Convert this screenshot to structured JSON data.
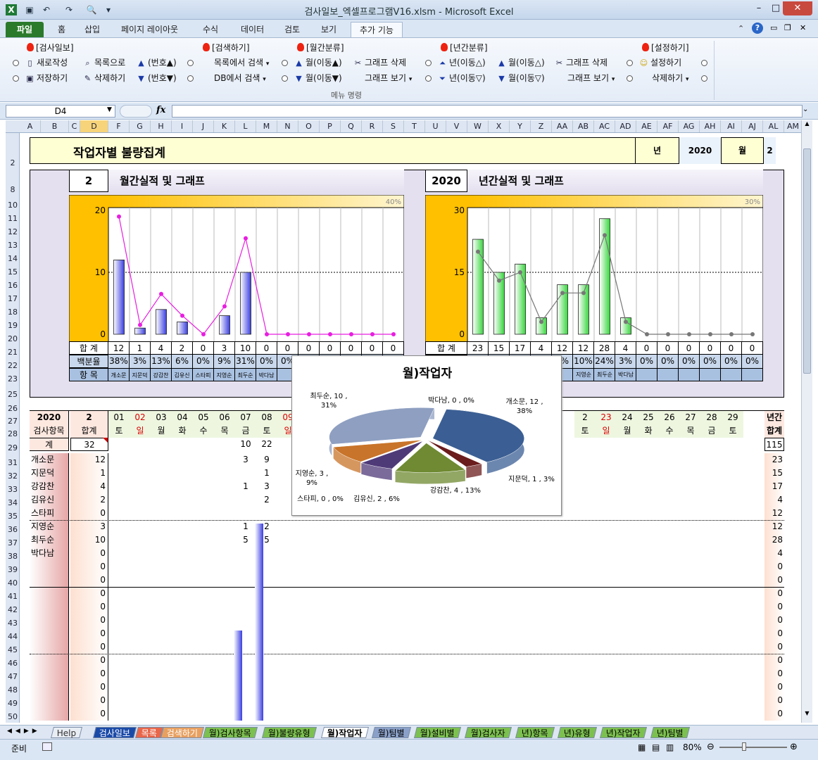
{
  "window": {
    "title": "검사일보_엑셀프로그램V16.xlsm  -  Microsoft Excel"
  },
  "ribbon_tabs": [
    "파일",
    "홈",
    "삽입",
    "페이지 레이아웃",
    "수식",
    "데이터",
    "검토",
    "보기",
    "추가 기능"
  ],
  "ribbon": {
    "groups": [
      "[검사일보]",
      "[검색하기]",
      "[월간분류]",
      "[년간분류]",
      "[설정하기]"
    ],
    "items": {
      "new": "새로작성",
      "save": "저장하기",
      "tolist": "목록으로",
      "delete": "삭제하기",
      "num_up": "(번호▲)",
      "num_down": "(번호▼)",
      "search_list": "목록에서 검색",
      "search_db": "DB에서 검색",
      "month_up": "월(이동▲)",
      "month_down": "월(이동▼)",
      "m_graph_del": "그래프 삭제",
      "m_graph_view": "그래프 보기",
      "year_up": "년(이동△)",
      "year_down": "년(이동▽)",
      "ym_up": "월(이동△)",
      "ym_down": "월(이동▽)",
      "y_graph_del": "그래프 삭제",
      "y_graph_view": "그래프 보기",
      "settings": "설정하기",
      "settings_del": "삭제하기"
    },
    "group_label": "메뉴 명령"
  },
  "namebox": "D4",
  "columns": [
    "A",
    "B",
    "C",
    "D",
    "F",
    "G",
    "H",
    "I",
    "J",
    "K",
    "L",
    "M",
    "N",
    "O",
    "P",
    "Q",
    "R",
    "S",
    "T",
    "U",
    "V",
    "W",
    "X",
    "Y",
    "Z",
    "AA",
    "AB",
    "AC",
    "AD",
    "AE",
    "AF",
    "AG",
    "AH",
    "AI",
    "AJ",
    "AL",
    "AM"
  ],
  "rows": [
    "2",
    "8",
    "10",
    "11",
    "12",
    "13",
    "14",
    "15",
    "16",
    "17",
    "18",
    "19",
    "20",
    "21",
    "22",
    "23",
    "25",
    "26",
    "27",
    "28",
    "29",
    "31",
    "32",
    "33",
    "34",
    "35",
    "36",
    "37",
    "38",
    "39",
    "40",
    "41",
    "42",
    "43",
    "44",
    "45",
    "46",
    "47",
    "48",
    "49",
    "50"
  ],
  "sheet": {
    "title": "작업자별 불량집계",
    "year_label": "년",
    "year": "2020",
    "month_label": "월",
    "month": "2",
    "monthly_header": {
      "num": "2",
      "text": "월간실적 및 그래프"
    },
    "yearly_header": {
      "num": "2020",
      "text": "년간실적 및 그래프"
    },
    "row_total": "합 계",
    "row_pct": "백분율",
    "row_item": "항 목",
    "grid_year": "2020",
    "grid_month": "2",
    "grid_item_hdr": "검사항목",
    "grid_sum_hdr": "합계",
    "grid_total_label": "계",
    "grid_total": "32",
    "grid_total_d07": "10",
    "grid_total_d08": "22",
    "grid_year_total_hdr1": "년간",
    "grid_year_total_hdr2": "합계",
    "grid_year_total": "115"
  },
  "days_left": [
    {
      "d": "01",
      "w": "토",
      "red": false
    },
    {
      "d": "02",
      "w": "일",
      "red": true
    },
    {
      "d": "03",
      "w": "월",
      "red": false
    },
    {
      "d": "04",
      "w": "화",
      "red": false
    },
    {
      "d": "05",
      "w": "수",
      "red": false
    },
    {
      "d": "06",
      "w": "목",
      "red": false
    },
    {
      "d": "07",
      "w": "금",
      "red": false
    },
    {
      "d": "08",
      "w": "토",
      "red": false
    },
    {
      "d": "09",
      "w": "일",
      "red": true
    }
  ],
  "days_right": [
    {
      "d": "2",
      "w": "토",
      "red": false
    },
    {
      "d": "23",
      "w": "일",
      "red": true
    },
    {
      "d": "24",
      "w": "월",
      "red": false
    },
    {
      "d": "25",
      "w": "화",
      "red": false
    },
    {
      "d": "26",
      "w": "수",
      "red": false
    },
    {
      "d": "27",
      "w": "목",
      "red": false
    },
    {
      "d": "28",
      "w": "금",
      "red": false
    },
    {
      "d": "29",
      "w": "토",
      "red": false
    }
  ],
  "workers": [
    {
      "name": "개소문",
      "sum": "12",
      "d07": "3",
      "d08": "9",
      "year": "23"
    },
    {
      "name": "지문덕",
      "sum": "1",
      "d07": "",
      "d08": "1",
      "year": "15"
    },
    {
      "name": "강감찬",
      "sum": "4",
      "d07": "1",
      "d08": "3",
      "year": "17"
    },
    {
      "name": "김유신",
      "sum": "2",
      "d07": "",
      "d08": "2",
      "year": "4"
    },
    {
      "name": "스타피",
      "sum": "0",
      "d07": "",
      "d08": "",
      "year": "12"
    },
    {
      "name": "지영순",
      "sum": "3",
      "d07": "1",
      "d08": "2",
      "year": "12"
    },
    {
      "name": "최두순",
      "sum": "10",
      "d07": "5",
      "d08": "5",
      "year": "28"
    },
    {
      "name": "박다남",
      "sum": "0",
      "d07": "",
      "d08": "",
      "year": "4"
    },
    {
      "name": "",
      "sum": "0",
      "d07": "",
      "d08": "",
      "year": "0"
    },
    {
      "name": "",
      "sum": "0",
      "d07": "",
      "d08": "",
      "year": "0"
    },
    {
      "name": "",
      "sum": "0",
      "d07": "",
      "d08": "",
      "year": "0"
    },
    {
      "name": "",
      "sum": "0",
      "d07": "",
      "d08": "",
      "year": "0"
    },
    {
      "name": "",
      "sum": "0",
      "d07": "",
      "d08": "",
      "year": "0"
    },
    {
      "name": "",
      "sum": "0",
      "d07": "",
      "d08": "",
      "year": "0"
    },
    {
      "name": "",
      "sum": "0",
      "d07": "",
      "d08": "",
      "year": "0"
    },
    {
      "name": "",
      "sum": "0",
      "d07": "",
      "d08": "",
      "year": "0"
    },
    {
      "name": "",
      "sum": "0",
      "d07": "",
      "d08": "",
      "year": "0"
    },
    {
      "name": "",
      "sum": "0",
      "d07": "",
      "d08": "",
      "year": "0"
    },
    {
      "name": "",
      "sum": "0",
      "d07": "",
      "d08": "",
      "year": "0"
    },
    {
      "name": "",
      "sum": "0",
      "d07": "",
      "d08": "",
      "year": "0"
    }
  ],
  "chart_data": [
    {
      "type": "bar",
      "name": "monthly",
      "categories": [
        "개소문",
        "지문덕",
        "강감찬",
        "김유신",
        "스타피",
        "지영순",
        "최두순",
        "박다남",
        "",
        "",
        "",
        "",
        "",
        "",
        ""
      ],
      "values": [
        12,
        1,
        4,
        2,
        0,
        3,
        10,
        0,
        0,
        0,
        0,
        0,
        0,
        0
      ],
      "pct_labels": [
        "38%",
        "3%",
        "13%",
        "6%",
        "0%",
        "9%",
        "31%",
        "0%",
        "0%",
        "",
        "",
        "",
        "",
        ""
      ],
      "line_pct": [
        38,
        3,
        13,
        6,
        0,
        9,
        31,
        0,
        0,
        0,
        0,
        0,
        0,
        0
      ],
      "ylim": [
        0,
        20
      ],
      "yticks": [
        "0",
        "10",
        "20"
      ],
      "y2max_label": "40%",
      "bar_color": "#3a3ee0",
      "line_color": "#e81ee0"
    },
    {
      "type": "bar",
      "name": "yearly",
      "categories": [
        "",
        "",
        "",
        "",
        "",
        "",
        "",
        "",
        "",
        "",
        "",
        "",
        "",
        ""
      ],
      "values": [
        23,
        15,
        17,
        4,
        12,
        12,
        28,
        4,
        0,
        0,
        0,
        0,
        0,
        0
      ],
      "pct_labels": [
        "",
        "",
        "",
        "",
        "0%",
        "10%",
        "24%",
        "3%",
        "0%",
        "0%",
        "0%",
        "0%",
        "0%",
        "0%"
      ],
      "line_pct": [
        20,
        13,
        15,
        3,
        10,
        10,
        24,
        3,
        0,
        0,
        0,
        0,
        0,
        0
      ],
      "ylim": [
        0,
        30
      ],
      "yticks": [
        "0",
        "15",
        "30"
      ],
      "y2max_label": "30%",
      "bar_color": "#36d63c",
      "line_color": "#777777"
    },
    {
      "type": "pie",
      "name": "월)작업자",
      "title": "월)작업자",
      "slices": [
        {
          "label": "개소문",
          "value": 12,
          "pct": "38%",
          "color": "#3b5f94"
        },
        {
          "label": "지문덕",
          "value": 1,
          "pct": "3%",
          "color": "#6b1c1c"
        },
        {
          "label": "강감찬",
          "value": 4,
          "pct": "13%",
          "color": "#6f8a32"
        },
        {
          "label": "김유신",
          "value": 2,
          "pct": "6%",
          "color": "#4f3a78"
        },
        {
          "label": "스타피",
          "value": 0,
          "pct": "0%",
          "color": "#2c7a84"
        },
        {
          "label": "지영순",
          "value": 3,
          "pct": "9%",
          "color": "#c8742a"
        },
        {
          "label": "최두순",
          "value": 10,
          "pct": "31%",
          "color": "#8e9fc1"
        },
        {
          "label": "박다남",
          "value": 0,
          "pct": "0%",
          "color": "#3f4a5c"
        }
      ],
      "data_labels": [
        "개소문, 12 ,\n38%",
        "지문덕, 1 , 3%",
        "강감찬, 4 , 13%",
        "김유신, 2 , 6%",
        "스타피, 0 , 0%",
        "지영순, 3 ,\n9%",
        "최두순, 10 ,\n31%",
        "박다남, 0 , 0%"
      ]
    }
  ],
  "sheet_tabs": [
    "Help",
    "검사일보",
    "목록",
    "검색하기",
    "월)검사항목",
    "월)불량유형",
    "월)작업자",
    "월)팀별",
    "월)설비별",
    "월)검사자",
    "년)항목",
    "년)유형",
    "년)작업자",
    "년)팀별"
  ],
  "status": {
    "ready": "준비",
    "zoom": "80%"
  }
}
